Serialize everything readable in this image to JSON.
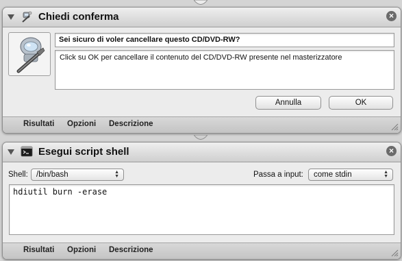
{
  "action1": {
    "title": "Chiedi conferma",
    "icon": "robot-automator-icon",
    "question": "Sei sicuro di voler cancellare questo CD/DVD-RW?",
    "message": "Click su OK per cancellare il contenuto del CD/DVD-RW presente nel masterizzatore",
    "cancel_label": "Annulla",
    "ok_label": "OK",
    "footer_tabs": [
      "Risultati",
      "Opzioni",
      "Descrizione"
    ]
  },
  "action2": {
    "title": "Esegui script shell",
    "icon": "terminal-icon",
    "shell_label": "Shell:",
    "shell_value": "/bin/bash",
    "pass_input_label": "Passa a input:",
    "pass_input_value": "come stdin",
    "script": "hdiutil burn -erase",
    "footer_tabs": [
      "Risultati",
      "Opzioni",
      "Descrizione"
    ]
  }
}
